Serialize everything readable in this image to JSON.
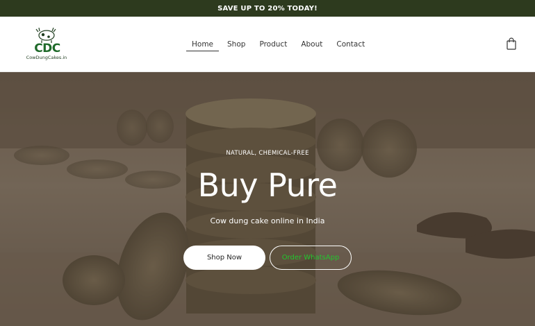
{
  "promo": {
    "text": "SAVE UP TO 20% TODAY!"
  },
  "logo": {
    "letters": "CDC",
    "site": "CowDungCakes.in",
    "icon": "cow-icon"
  },
  "nav": {
    "items": [
      {
        "label": "Home",
        "active": true
      },
      {
        "label": "Shop"
      },
      {
        "label": "Product"
      },
      {
        "label": "About"
      },
      {
        "label": "Contact"
      }
    ]
  },
  "cart": {
    "icon": "shopping-bag-icon"
  },
  "hero": {
    "tag": "NATURAL, CHEMICAL-FREE",
    "title": "Buy Pure",
    "subtitle": "Cow dung cake online in India",
    "primary_button": "Shop Now",
    "secondary_button": "Order WhatsApp"
  },
  "colors": {
    "promo_bg": "#2d3a1e",
    "brand_green": "#1f6a2a",
    "whatsapp_green": "#22c52e"
  }
}
